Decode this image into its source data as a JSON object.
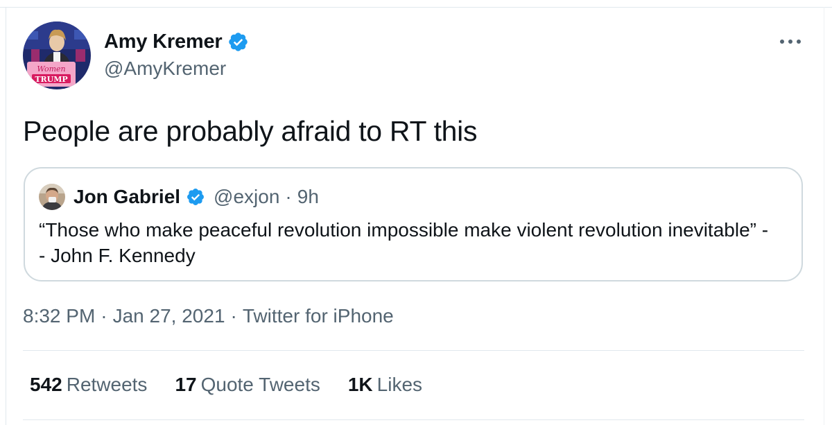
{
  "tweet": {
    "author": {
      "name": "Amy Kremer",
      "handle": "@AmyKremer",
      "avatar_sign_line1": "Women",
      "avatar_sign_line2": "TRUMP",
      "avatar_icon": "user-avatar-photo",
      "verified_icon": "verified-badge-icon"
    },
    "more_icon": "more-options-icon",
    "text": "People are probably afraid to RT this",
    "quoted": {
      "name": "Jon Gabriel",
      "handle": "@exjon",
      "separator": "·",
      "time": "9h",
      "text": "“Those who make peaceful revolution impossible make violent revolution inevitable” -- John F. Kennedy"
    },
    "timestamp": {
      "time": "8:32 PM",
      "date": "Jan 27, 2021",
      "source": "Twitter for iPhone",
      "separator": "·"
    },
    "stats": [
      {
        "count": "542",
        "label": "Retweets"
      },
      {
        "count": "17",
        "label": "Quote Tweets"
      },
      {
        "count": "1K",
        "label": "Likes"
      }
    ],
    "colors": {
      "text_primary": "#0f1419",
      "text_secondary": "#536471",
      "verified": "#1d9bf0",
      "border": "#cfd9de"
    }
  }
}
